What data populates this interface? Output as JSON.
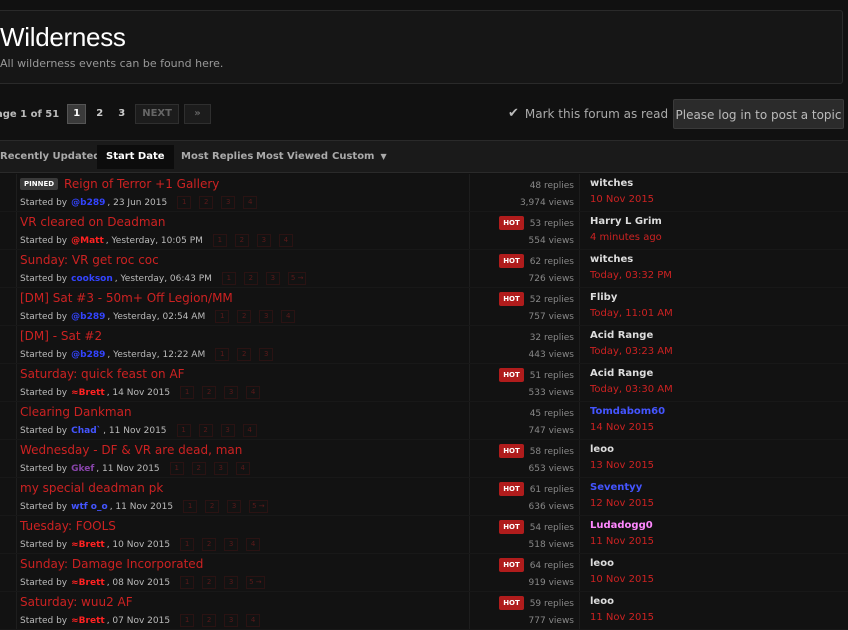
{
  "header": {
    "title": "Wilderness",
    "subtitle": "All wilderness events can be found here."
  },
  "pagination": {
    "label": "age 1 of 51",
    "pages": [
      "1",
      "2",
      "3"
    ],
    "current": "1",
    "next_label": "NEXT",
    "last_label": "»"
  },
  "actions": {
    "mark_read": "Mark this forum as read",
    "login_button": "Please log in to post a topic"
  },
  "sort_tabs": [
    {
      "label": "Recently Updated",
      "active": false
    },
    {
      "label": "Start Date",
      "active": true
    },
    {
      "label": "Most Replies",
      "active": false
    },
    {
      "label": "Most Viewed",
      "active": false
    },
    {
      "label": "Custom",
      "active": false
    }
  ],
  "colors": {
    "accent_red": "#cc2222",
    "hot_badge": "#b01c1c",
    "member_blue": "#3344ff",
    "admin_red": "#ff2222",
    "purple": "#8844aa",
    "pink": "#ff88ff",
    "link_blue": "#4455ff"
  },
  "topics": [
    {
      "pinned": true,
      "pinned_label": "PINNED",
      "title": "Reign of Terror +1 Gallery",
      "started_by": "Started by",
      "author": "@b289",
      "author_color": "#3344ff",
      "date": ", 23 Jun 2015",
      "pages": [
        "1",
        "2",
        "3",
        "4"
      ],
      "hot": false,
      "replies": "48 replies",
      "views": "3,974 views",
      "last_user": "witches",
      "last_user_color": "#dddddd",
      "last_time": "10 Nov 2015"
    },
    {
      "pinned": false,
      "title": "VR cleared on Deadman",
      "started_by": "Started by",
      "author": "@Matt",
      "author_color": "#ff2222",
      "date": ", Yesterday, 10:05 PM",
      "pages": [
        "1",
        "2",
        "3",
        "4"
      ],
      "hot": true,
      "hot_label": "HOT",
      "replies": "53 replies",
      "views": "554 views",
      "last_user": "Harry L Grim",
      "last_user_color": "#dddddd",
      "last_time": "4 minutes ago"
    },
    {
      "pinned": false,
      "title": "Sunday: VR get roc coc",
      "started_by": "Started by",
      "author": "cookson",
      "author_color": "#3344ff",
      "date": ", Yesterday, 06:43 PM",
      "pages": [
        "1",
        "2",
        "3",
        "5 →"
      ],
      "hot": true,
      "hot_label": "HOT",
      "replies": "62 replies",
      "views": "726 views",
      "last_user": "witches",
      "last_user_color": "#dddddd",
      "last_time": "Today, 03:32 PM"
    },
    {
      "pinned": false,
      "title": "[DM] Sat #3 - 50m+ Off Legion/MM",
      "started_by": "Started by",
      "author": "@b289",
      "author_color": "#3344ff",
      "date": ", Yesterday, 02:54 AM",
      "pages": [
        "1",
        "2",
        "3",
        "4"
      ],
      "hot": true,
      "hot_label": "HOT",
      "replies": "52 replies",
      "views": "757 views",
      "last_user": "Fliby",
      "last_user_color": "#dddddd",
      "last_time": "Today, 11:01 AM"
    },
    {
      "pinned": false,
      "title": "[DM] - Sat #2",
      "started_by": "Started by",
      "author": "@b289",
      "author_color": "#3344ff",
      "date": ", Yesterday, 12:22 AM",
      "pages": [
        "1",
        "2",
        "3"
      ],
      "hot": false,
      "replies": "32 replies",
      "views": "443 views",
      "last_user": "Acid Range",
      "last_user_color": "#dddddd",
      "last_time": "Today, 03:23 AM"
    },
    {
      "pinned": false,
      "title": "Saturday: quick feast on AF",
      "started_by": "Started by",
      "author": "≈Brett",
      "author_color": "#ff2222",
      "date": ", 14 Nov 2015",
      "pages": [
        "1",
        "2",
        "3",
        "4"
      ],
      "hot": true,
      "hot_label": "HOT",
      "replies": "51 replies",
      "views": "533 views",
      "last_user": "Acid Range",
      "last_user_color": "#dddddd",
      "last_time": "Today, 03:30 AM"
    },
    {
      "pinned": false,
      "title": "Clearing Dankman",
      "started_by": "Started by",
      "author": "Chad`",
      "author_color": "#4455ff",
      "date": ", 11 Nov 2015",
      "pages": [
        "1",
        "2",
        "3",
        "4"
      ],
      "hot": false,
      "replies": "45 replies",
      "views": "747 views",
      "last_user": "Tomdabom60",
      "last_user_color": "#4455ff",
      "last_time": "14 Nov 2015"
    },
    {
      "pinned": false,
      "title": "Wednesday - DF & VR are dead, man",
      "started_by": "Started by",
      "author": "Gkef",
      "author_color": "#8844aa",
      "date": ", 11 Nov 2015",
      "pages": [
        "1",
        "2",
        "3",
        "4"
      ],
      "hot": true,
      "hot_label": "HOT",
      "replies": "58 replies",
      "views": "653 views",
      "last_user": "leoo",
      "last_user_color": "#dddddd",
      "last_time": "13 Nov 2015"
    },
    {
      "pinned": false,
      "title": "my special deadman pk",
      "started_by": "Started by",
      "author": "wtf o_o",
      "author_color": "#4455ff",
      "date": ", 11 Nov 2015",
      "pages": [
        "1",
        "2",
        "3",
        "5 →"
      ],
      "hot": true,
      "hot_label": "HOT",
      "replies": "61 replies",
      "views": "636 views",
      "last_user": "Seventyy",
      "last_user_color": "#4455ff",
      "last_time": "12 Nov 2015"
    },
    {
      "pinned": false,
      "title": "Tuesday: FOOLS",
      "started_by": "Started by",
      "author": "≈Brett",
      "author_color": "#ff2222",
      "date": ", 10 Nov 2015",
      "pages": [
        "1",
        "2",
        "3",
        "4"
      ],
      "hot": true,
      "hot_label": "HOT",
      "replies": "54 replies",
      "views": "518 views",
      "last_user": "Ludadogg0",
      "last_user_color": "#ff88ff",
      "last_time": "11 Nov 2015"
    },
    {
      "pinned": false,
      "title": "Sunday: Damage Incorporated",
      "started_by": "Started by",
      "author": "≈Brett",
      "author_color": "#ff2222",
      "date": ", 08 Nov 2015",
      "pages": [
        "1",
        "2",
        "3",
        "5 →"
      ],
      "hot": true,
      "hot_label": "HOT",
      "replies": "64 replies",
      "views": "919 views",
      "last_user": "leoo",
      "last_user_color": "#dddddd",
      "last_time": "10 Nov 2015"
    },
    {
      "pinned": false,
      "title": "Saturday: wuu2 AF",
      "started_by": "Started by",
      "author": "≈Brett",
      "author_color": "#ff2222",
      "date": ", 07 Nov 2015",
      "pages": [
        "1",
        "2",
        "3",
        "4"
      ],
      "hot": true,
      "hot_label": "HOT",
      "replies": "59 replies",
      "views": "777 views",
      "last_user": "leoo",
      "last_user_color": "#dddddd",
      "last_time": "11 Nov 2015"
    }
  ]
}
